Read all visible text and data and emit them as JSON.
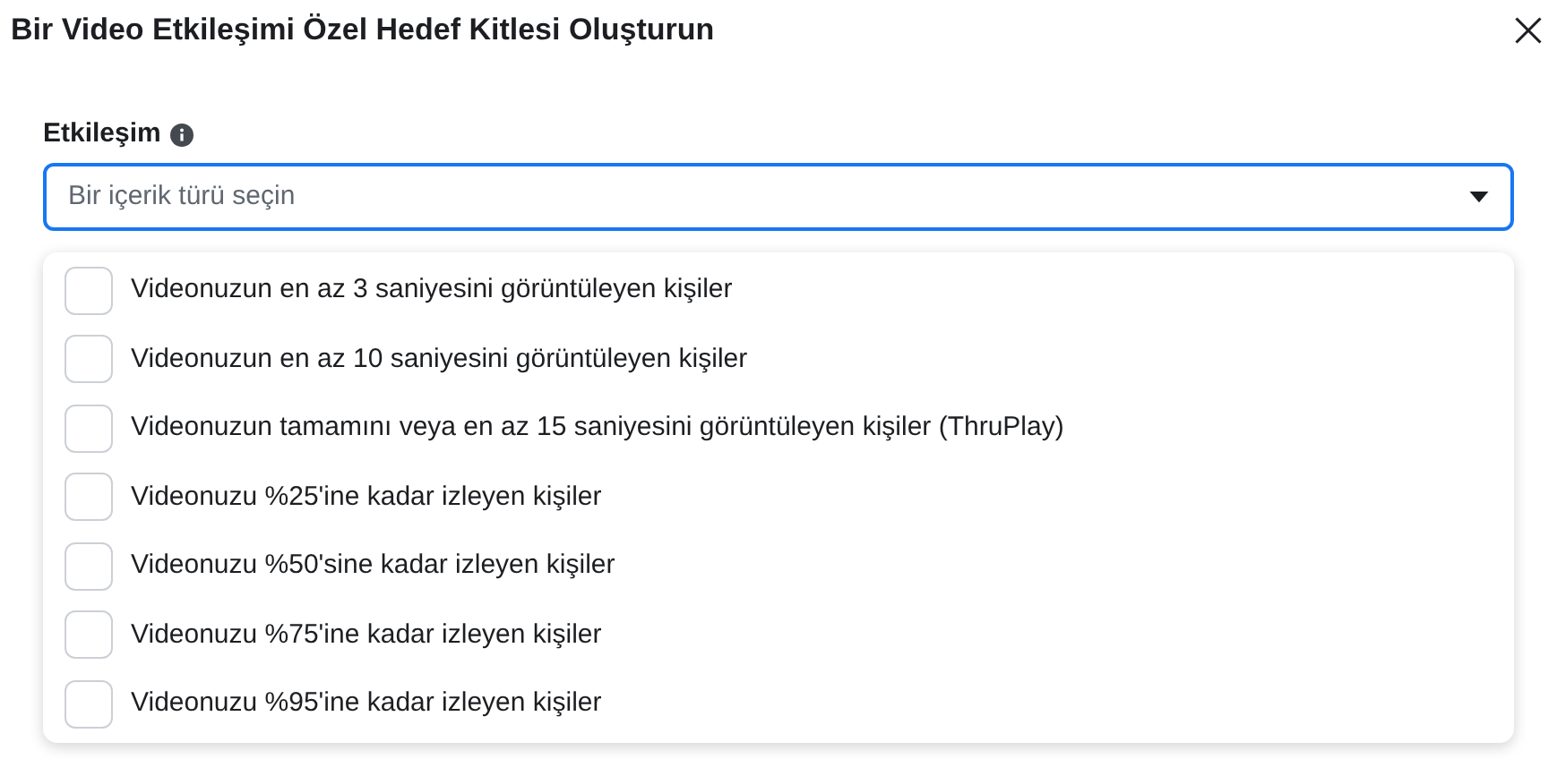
{
  "dialog": {
    "title": "Bir Video Etkileşimi Özel Hedef Kitlesi Oluşturun"
  },
  "field": {
    "label": "Etkileşim",
    "placeholder": "Bir içerik türü seçin",
    "expanded": true
  },
  "options": [
    {
      "label": "Videonuzun en az 3 saniyesini görüntüleyen kişiler",
      "checked": false
    },
    {
      "label": "Videonuzun en az 10 saniyesini görüntüleyen kişiler",
      "checked": false
    },
    {
      "label": "Videonuzun tamamını veya en az 15 saniyesini görüntüleyen kişiler (ThruPlay)",
      "checked": false
    },
    {
      "label": "Videonuzu %25'ine kadar izleyen kişiler",
      "checked": false
    },
    {
      "label": "Videonuzu %50'sine kadar izleyen kişiler",
      "checked": false
    },
    {
      "label": "Videonuzu %75'ine kadar izleyen kişiler",
      "checked": false
    },
    {
      "label": "Videonuzu %95'ine kadar izleyen kişiler",
      "checked": false
    }
  ]
}
